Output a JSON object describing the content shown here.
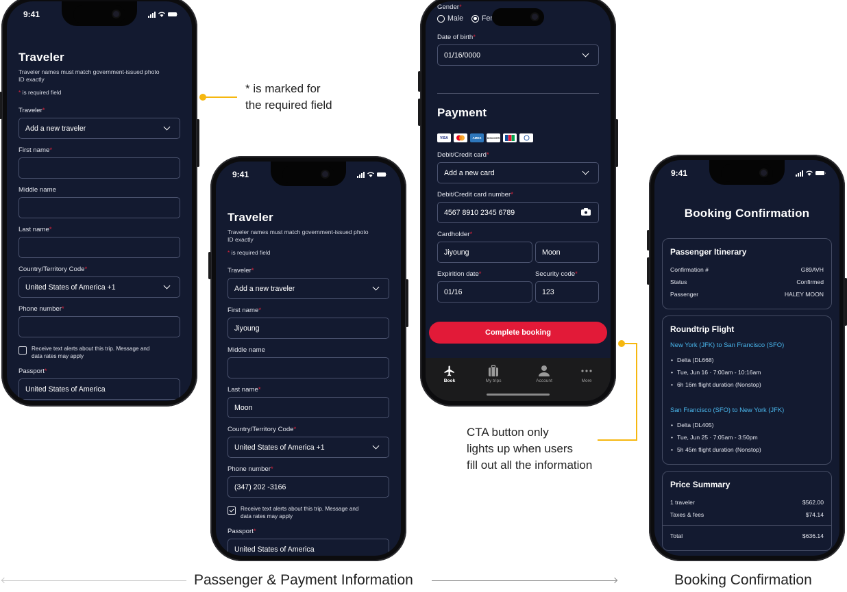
{
  "status_time": "9:41",
  "required_mark": "*",
  "colors": {
    "accent_red": "#e21a38",
    "annotation_yellow": "#f6b70f",
    "screen_bg": "#131a30",
    "route_blue": "#4ab8ee"
  },
  "phone1": {
    "title": "Traveler",
    "subtitle": "Traveler names must match government-issued photo ID exactly",
    "required_note": "is required field",
    "fields": {
      "traveler": {
        "label": "Traveler",
        "value": "Add a new traveler"
      },
      "first_name": {
        "label": "First name",
        "value": ""
      },
      "middle_name": {
        "label": "Middle name",
        "value": ""
      },
      "last_name": {
        "label": "Last name",
        "value": ""
      },
      "country": {
        "label": "Country/Territory Code",
        "value": "United States of America +1"
      },
      "phone": {
        "label": "Phone number",
        "value": ""
      },
      "passport": {
        "label": "Passport",
        "value": "United States of America"
      }
    },
    "sms_checkbox": {
      "label": "Receive text alerts about this trip. Message and data rates may apply",
      "checked": false
    }
  },
  "phone2": {
    "title": "Traveler",
    "subtitle": "Traveler names must match government-issued photo ID exactly",
    "required_note": "is required field",
    "fields": {
      "traveler": {
        "label": "Traveler",
        "value": "Add a new traveler"
      },
      "first_name": {
        "label": "First name",
        "value": "Jiyoung"
      },
      "middle_name": {
        "label": "Middle name",
        "value": ""
      },
      "last_name": {
        "label": "Last name",
        "value": "Moon"
      },
      "country": {
        "label": "Country/Territory Code",
        "value": "United States of America +1"
      },
      "phone": {
        "label": "Phone number",
        "value": "(347) 202 -3166"
      },
      "passport": {
        "label": "Passport",
        "value": "United States of America"
      }
    },
    "sms_checkbox": {
      "label": "Receive text alerts about this trip. Message and data rates may apply",
      "checked": true
    }
  },
  "phone3": {
    "gender": {
      "label": "Gender",
      "options": [
        "Male",
        "Female"
      ],
      "selected": "Female",
      "visible_female": "Fema"
    },
    "dob": {
      "label": "Date of birth",
      "value": "01/16/0000"
    },
    "payment_title": "Payment",
    "card_brands": [
      "VISA",
      "Mastercard",
      "AMEX",
      "DISCOVER",
      "JCB",
      "Diners Club"
    ],
    "card_select": {
      "label": "Debit/Credit card",
      "value": "Add a new card"
    },
    "card_number": {
      "label": "Debit/Credit card number",
      "value": "4567 8910 2345 6789"
    },
    "cardholder": {
      "label": "Cardholder",
      "first": "Jiyoung",
      "last": "Moon"
    },
    "expiration": {
      "label": "Expirition date",
      "value": "01/16"
    },
    "security": {
      "label": "Security code",
      "value": "123"
    },
    "cta": "Complete booking",
    "tabs": [
      {
        "label": "Book",
        "icon": "airplane-icon",
        "active": true
      },
      {
        "label": "My trips",
        "icon": "luggage-icon",
        "active": false
      },
      {
        "label": "Account",
        "icon": "person-icon",
        "active": false
      },
      {
        "label": "More",
        "icon": "more-dots-icon",
        "active": false
      }
    ]
  },
  "phone4": {
    "title": "Booking Confirmation",
    "itinerary": {
      "title": "Passenger Itinerary",
      "rows": [
        {
          "key": "Confirmation #",
          "value": "G89AVH"
        },
        {
          "key": "Status",
          "value": "Confirmed"
        },
        {
          "key": "Passenger",
          "value": "HALEY MOON"
        }
      ]
    },
    "flight": {
      "title": "Roundtrip Flight",
      "legs": [
        {
          "route": "New York (JFK) to San Francisco (SFO)",
          "details": [
            "Delta (DL668)",
            "Tue, Jun 16 · 7:00am - 10:16am",
            "6h 16m flight duration (Nonstop)"
          ]
        },
        {
          "route": "San Francisco (SFO) to New York (JFK)",
          "details": [
            "Delta (DL405)",
            "Tue, Jun 25 · 7:05am - 3:50pm",
            "5h 45m flight duration (Nonstop)"
          ]
        }
      ]
    },
    "price": {
      "title": "Price Summary",
      "rows": [
        {
          "key": "1 traveler",
          "value": "$562.00"
        },
        {
          "key": "Taxes & fees",
          "value": "$74.14"
        }
      ],
      "total": {
        "key": "Total",
        "value": "$636.14"
      }
    }
  },
  "annotations": {
    "required": "* is marked for the required field",
    "required_line1": "* is marked for",
    "required_line2": "the required field",
    "cta_line1": "CTA button only",
    "cta_line2": "lights up when users",
    "cta_line3": "fill out all the information"
  },
  "captions": {
    "left": "Passenger & Payment Information",
    "right": "Booking Confirmation"
  }
}
